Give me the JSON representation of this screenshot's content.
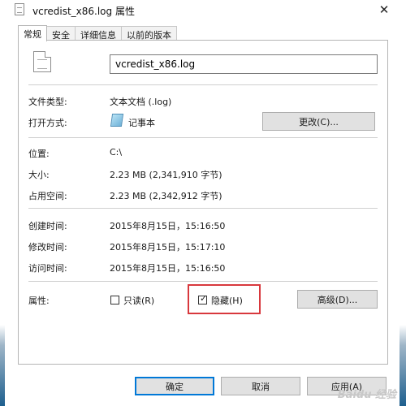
{
  "window": {
    "title": "vcredist_x86.log 属性",
    "close_symbol": "✕"
  },
  "tabs": [
    {
      "label": "常规",
      "active": true
    },
    {
      "label": "安全",
      "active": false
    },
    {
      "label": "详细信息",
      "active": false
    },
    {
      "label": "以前的版本",
      "active": false
    }
  ],
  "general": {
    "filename": "vcredist_x86.log",
    "file_type_label": "文件类型:",
    "file_type_value": "文本文档 (.log)",
    "open_with_label": "打开方式:",
    "open_with_value": "记事本",
    "change_button": "更改(C)...",
    "location_label": "位置:",
    "location_value": "C:\\",
    "size_label": "大小:",
    "size_value": "2.23 MB (2,341,910 字节)",
    "disk_size_label": "占用空间:",
    "disk_size_value": "2.23 MB (2,342,912 字节)",
    "created_label": "创建时间:",
    "created_value": "2015年8月15日，15:16:50",
    "modified_label": "修改时间:",
    "modified_value": "2015年8月15日，15:17:10",
    "accessed_label": "访问时间:",
    "accessed_value": "2015年8月15日，15:16:50",
    "attributes_label": "属性:",
    "readonly_label": "只读(R)",
    "readonly_checked": false,
    "hidden_label": "隐藏(H)",
    "hidden_checked": true,
    "checkmark": "✓",
    "advanced_button": "高级(D)..."
  },
  "footer": {
    "ok_button": "确定",
    "cancel_button": "取消",
    "apply_button": "应用(A)",
    "watermark": "Baidu 经验"
  },
  "icons": {
    "title": "log-file-icon",
    "file": "log-file-icon",
    "open_with": "notepad-icon",
    "close": "close-icon"
  },
  "colors": {
    "highlight": "#d8383d",
    "button_bg": "#e1e1e1",
    "taskbar": "#1e5f8e"
  }
}
